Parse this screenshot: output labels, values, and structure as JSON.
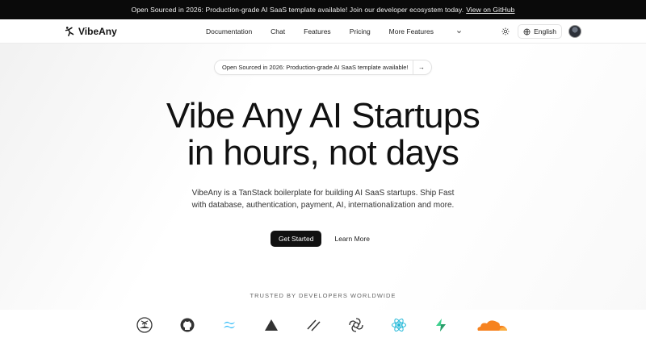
{
  "announcement": {
    "text": "Open Sourced in 2026: Production-grade AI SaaS template available! Join our developer ecosystem today.",
    "link": "View on GitHub"
  },
  "nav": {
    "brand": "VibeAny",
    "links": [
      "Documentation",
      "Chat",
      "Features",
      "Pricing"
    ],
    "more": "More Features",
    "language": "English"
  },
  "hero": {
    "pill_text": "Open Sourced in 2026: Production-grade AI SaaS template available!",
    "headline_line1": "Vibe Any AI Startups",
    "headline_line2": "in hours, not days",
    "sub_line1": "VibeAny is a TanStack boilerplate for building AI SaaS startups. Ship Fast",
    "sub_line2": "with database, authentication, payment, AI, internationalization and more.",
    "primary_cta": "Get Started",
    "secondary_cta": "Learn More"
  },
  "trusted": {
    "label": "TRUSTED BY DEVELOPERS WORLDWIDE",
    "logos": [
      "island-icon",
      "github-icon",
      "tailwind-icon",
      "triangle-icon",
      "slashes-icon",
      "openai-icon",
      "react-icon",
      "supabase-icon",
      "cloudflare-icon"
    ]
  }
}
